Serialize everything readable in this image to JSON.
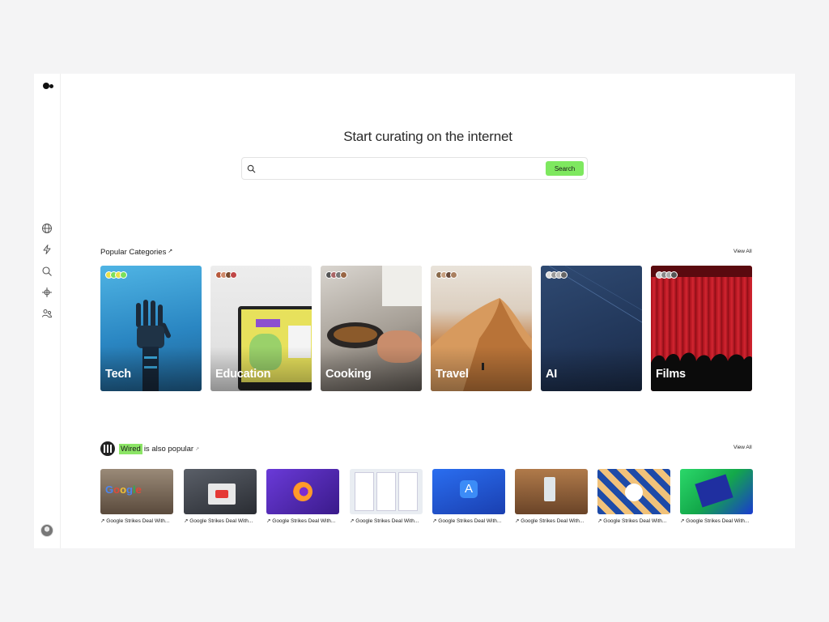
{
  "hero": {
    "title": "Start curating on the internet"
  },
  "search": {
    "placeholder": "",
    "button_label": "Search"
  },
  "popular": {
    "title": "Popular Categories",
    "view_all": "View All",
    "categories": [
      {
        "label": "Tech"
      },
      {
        "label": "Education"
      },
      {
        "label": "Cooking"
      },
      {
        "label": "Travel"
      },
      {
        "label": "AI"
      },
      {
        "label": "Films"
      }
    ]
  },
  "wired": {
    "brand": "Wired",
    "suffix": " is also popular",
    "view_all": "View All",
    "articles": [
      {
        "caption": "Google Strikes Deal With..."
      },
      {
        "caption": "Google Strikes Deal With..."
      },
      {
        "caption": "Google Strikes Deal With..."
      },
      {
        "caption": "Google Strikes Deal With..."
      },
      {
        "caption": "Google Strikes Deal With..."
      },
      {
        "caption": "Google Strikes Deal With..."
      },
      {
        "caption": "Google Strikes Deal With..."
      },
      {
        "caption": "Google Strikes Deal With..."
      }
    ]
  },
  "sidebar": {
    "icons": [
      "globe-icon",
      "bolt-icon",
      "search-icon",
      "crosshair-icon",
      "users-icon"
    ]
  },
  "colors": {
    "accent": "#7ee85f",
    "highlight": "#8ce566"
  }
}
